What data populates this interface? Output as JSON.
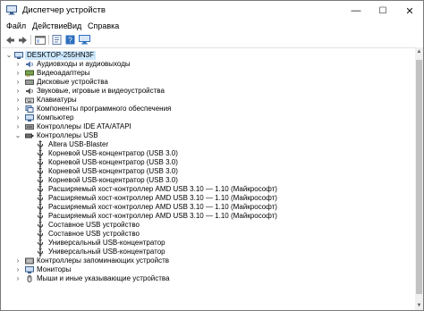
{
  "window": {
    "title": "Диспетчер устройств",
    "controls": {
      "minimize": "—",
      "maximize": "☐",
      "close": "✕"
    }
  },
  "menu": [
    "Файл",
    "Действие",
    "Вид",
    "Справка"
  ],
  "toolbar": [
    "back-icon",
    "forward-icon",
    "show-hide-tree-icon",
    "properties-icon",
    "help-icon",
    "scan-hardware-icon"
  ],
  "tree": {
    "root": "DESKTOP-255HN3F",
    "categories": [
      {
        "label": "Аудиовходы и аудиовыходы",
        "icon": "audio-io-icon",
        "expanded": false
      },
      {
        "label": "Видеоадаптеры",
        "icon": "display-adapter-icon",
        "expanded": false
      },
      {
        "label": "Дисковые устройства",
        "icon": "disk-drive-icon",
        "expanded": false
      },
      {
        "label": "Звуковые, игровые и видеоустройства",
        "icon": "sound-device-icon",
        "expanded": false
      },
      {
        "label": "Клавиатуры",
        "icon": "keyboard-icon",
        "expanded": false
      },
      {
        "label": "Компоненты программного обеспечения",
        "icon": "software-component-icon",
        "expanded": false
      },
      {
        "label": "Компьютер",
        "icon": "computer-icon",
        "expanded": false
      },
      {
        "label": "Контроллеры IDE ATA/ATAPI",
        "icon": "ide-controller-icon",
        "expanded": false
      },
      {
        "label": "Контроллеры USB",
        "icon": "usb-controller-icon",
        "expanded": true
      },
      {
        "label": "Контроллеры запоминающих устройств",
        "icon": "storage-controller-icon",
        "expanded": false
      },
      {
        "label": "Мониторы",
        "icon": "monitor-icon",
        "expanded": false
      },
      {
        "label": "Мыши и иные указывающие устройства",
        "icon": "mouse-icon",
        "expanded": false
      }
    ],
    "usb_children": [
      "Altera USB-Blaster",
      "Корневой USB-концентратор (USB 3.0)",
      "Корневой USB-концентратор (USB 3.0)",
      "Корневой USB-концентратор (USB 3.0)",
      "Корневой USB-концентратор (USB 3.0)",
      "Расширяемый хост-контроллер AMD USB 3.10 — 1.10 (Майкрософт)",
      "Расширяемый хост-контроллер AMD USB 3.10 — 1.10 (Майкрософт)",
      "Расширяемый хост-контроллер AMD USB 3.10 — 1.10 (Майкрософт)",
      "Расширяемый хост-контроллер AMD USB 3.10 — 1.10 (Майкрософт)",
      "Составное USB устройство",
      "Составное USB устройство",
      "Универсальный USB-концентратор",
      "Универсальный USB-концентратор"
    ]
  },
  "colors": {
    "selection": "#cce8ff",
    "usb_icon": "#3a3a3a",
    "device_icon": "#4a6fa5"
  }
}
